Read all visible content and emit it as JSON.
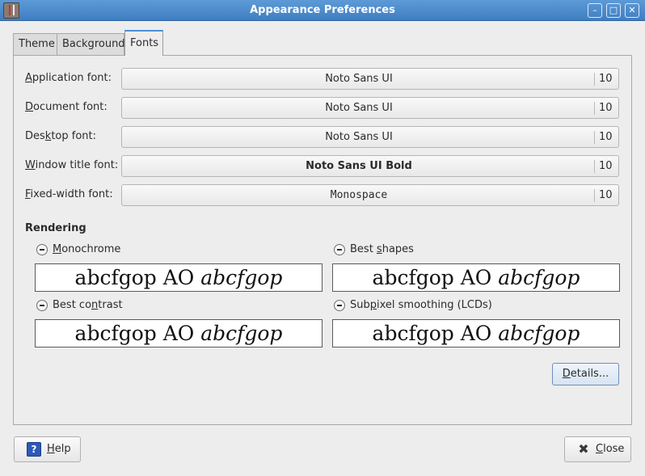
{
  "window": {
    "title": "Appearance Preferences",
    "minimize_glyph": "–",
    "maximize_glyph": "□",
    "close_glyph": "✕"
  },
  "tabs": [
    {
      "label": "Theme"
    },
    {
      "label": "Background"
    },
    {
      "label": "Fonts",
      "active": true
    }
  ],
  "fonts": {
    "application": {
      "label_pre": "",
      "label_key": "A",
      "label_post": "pplication font:",
      "name": "Noto Sans UI",
      "size": "10"
    },
    "document": {
      "label_pre": "",
      "label_key": "D",
      "label_post": "ocument font:",
      "name": "Noto Sans UI",
      "size": "10"
    },
    "desktop": {
      "label_pre": "Des",
      "label_key": "k",
      "label_post": "top font:",
      "name": "Noto Sans UI",
      "size": "10"
    },
    "window_title": {
      "label_pre": "",
      "label_key": "W",
      "label_post": "indow title font:",
      "name": "Noto Sans UI Bold",
      "size": "10"
    },
    "fixed_width": {
      "label_pre": "",
      "label_key": "F",
      "label_post": "ixed-width font:",
      "name": "Monospace",
      "size": "10"
    }
  },
  "rendering": {
    "title": "Rendering",
    "options": {
      "monochrome": {
        "pre": "",
        "key": "M",
        "post": "onochrome"
      },
      "best_shapes": {
        "pre": "Best ",
        "key": "s",
        "post": "hapes"
      },
      "best_contrast": {
        "pre": "Best co",
        "key": "n",
        "post": "trast"
      },
      "subpixel": {
        "pre": "Sub",
        "key": "p",
        "post": "ixel smoothing (LCDs)"
      }
    },
    "preview_regular": "abcfgop AO ",
    "preview_italic": "abcfgop"
  },
  "buttons": {
    "details_key": "D",
    "details_rest": "etails...",
    "help_key": "H",
    "help_rest": "elp",
    "help_icon": "?",
    "close_key": "C",
    "close_rest": "lose",
    "close_icon": "✖"
  }
}
